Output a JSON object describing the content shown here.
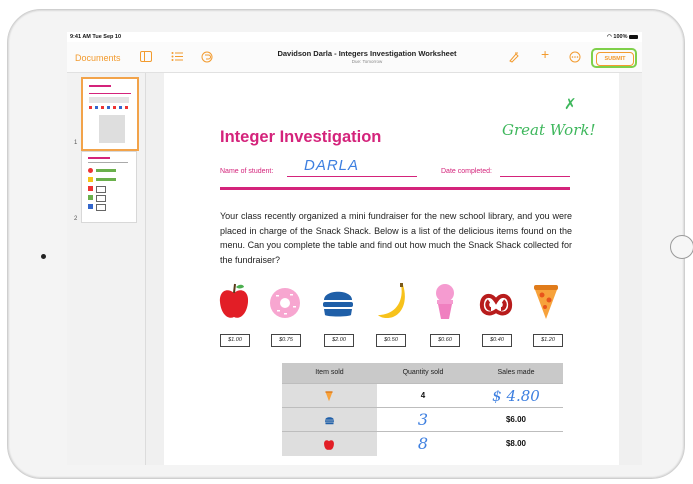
{
  "status_bar": {
    "time": "9:41 AM  Tue Sep 10",
    "battery": "100%"
  },
  "toolbar": {
    "documents_label": "Documents",
    "title": "Davidson Darla - Integers Investigation Worksheet",
    "subtitle": "Due: Tomorrow",
    "submit_label": "SUBMIT"
  },
  "sidebar": {
    "pages": [
      {
        "number": "1"
      },
      {
        "number": "2"
      }
    ]
  },
  "worksheet": {
    "title": "Integer Investigation",
    "grade_mark": "✗",
    "teacher_comment": "Great Work!",
    "name_label": "Name of student:",
    "student_name": "DARLA",
    "date_label": "Date completed:",
    "paragraph": "Your class recently organized a mini fundraiser for the new school library, and you were placed in charge of the Snack Shack. Below is a list of the delicious items found on the menu. Can you complete the table and find out how much the Snack Shack collected for the fundraiser?",
    "menu": [
      {
        "item": "apple-icon",
        "price": "$1.00"
      },
      {
        "item": "donut-icon",
        "price": "$0.75"
      },
      {
        "item": "burger-icon",
        "price": "$2.00"
      },
      {
        "item": "banana-icon",
        "price": "$0.50"
      },
      {
        "item": "ice-cream-icon",
        "price": "$0.60"
      },
      {
        "item": "pretzel-icon",
        "price": "$0.40"
      },
      {
        "item": "pizza-icon",
        "price": "$1.20"
      }
    ],
    "table": {
      "headers": [
        "Item sold",
        "Quantity sold",
        "Sales made"
      ],
      "rows": [
        {
          "item": "pizza-icon",
          "quantity": "4",
          "sales": "$ 4.80"
        },
        {
          "item": "burger-icon",
          "quantity": "3",
          "sales": "$6.00"
        },
        {
          "item": "apple-icon",
          "quantity": "8",
          "sales": "$8.00"
        }
      ]
    }
  },
  "colors": {
    "accent": "#f29b2f",
    "title_pink": "#d4237b",
    "teacher_green": "#3eb75c",
    "student_blue": "#3d7fe0",
    "submit_outline": "#7fd04a"
  }
}
